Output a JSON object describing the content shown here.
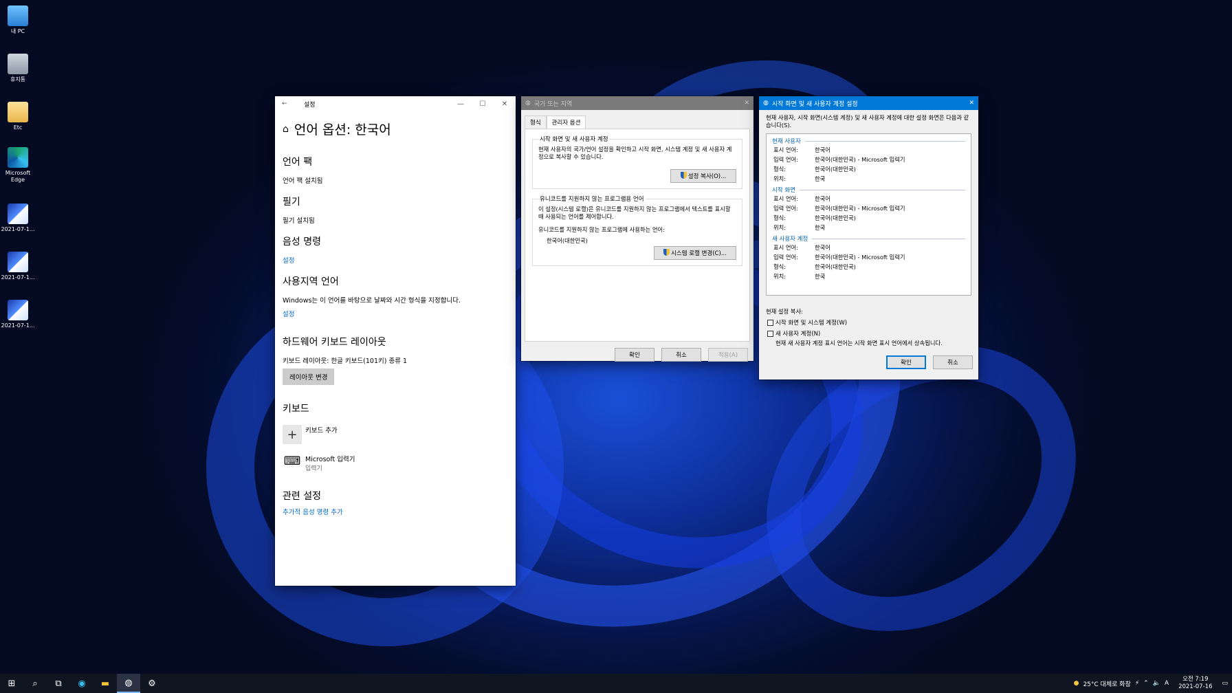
{
  "desktop": {
    "icons": [
      {
        "label": "내 PC",
        "icon": "pc-icon"
      },
      {
        "label": "휴지통",
        "icon": "recycle-bin-icon"
      },
      {
        "label": "Etc",
        "icon": "folder-icon"
      },
      {
        "label": "Microsoft Edge",
        "icon": "edge-icon"
      },
      {
        "label": "2021-07-1...",
        "icon": "image-file-icon"
      },
      {
        "label": "2021-07-1...",
        "icon": "image-file-icon"
      },
      {
        "label": "2021-07-1...",
        "icon": "image-file-icon"
      }
    ]
  },
  "settings": {
    "window_title": "설정",
    "page_title": "언어 옵션: 한국어",
    "language_pack": {
      "heading": "언어 팩",
      "status": "언어 팩 설치됨"
    },
    "handwriting": {
      "heading": "필기",
      "status": "필기 설치됨"
    },
    "speech": {
      "heading": "음성 명령",
      "link": "설정"
    },
    "regional": {
      "heading": "사용지역 언어",
      "description": "Windows는 이 언어를 바탕으로 날짜와 시간 형식을 지정합니다.",
      "link": "설정"
    },
    "hardware_keyboard": {
      "heading": "하드웨어 키보드 레이아웃",
      "layout_label": "키보드 레이아웃:",
      "layout_value": "한글 키보드(101키) 종류 1",
      "change_button": "레이아웃 변경"
    },
    "keyboards": {
      "heading": "키보드",
      "add_label": "키보드 추가",
      "ime_name": "Microsoft 입력기",
      "ime_sub": "입력기"
    },
    "related": {
      "heading": "관련 설정",
      "link": "추가적 음성 명령 추가"
    }
  },
  "region": {
    "window_title": "국가 또는 지역",
    "tabs": [
      "형식",
      "관리자 옵션"
    ],
    "welcome_group": {
      "legend": "시작 화면 및 새 사용자 계정",
      "text": "현재 사용자의 국가/언어 설정을 확인하고 시작 화면, 시스템 계정 및 새 사용자 계정으로 복사할 수 있습니다.",
      "button": "설정 복사(O)..."
    },
    "unicode_group": {
      "legend": "유니코드를 지원하지 않는 프로그램용 언어",
      "text": "이 설정(시스템 로캘)은 유니코드를 지원하지 않는 프로그램에서 텍스트를 표시할 때 사용되는 언어를 제어합니다.",
      "label": "유니코드를 지원하지 않는 프로그램에 사용하는 언어:",
      "value": "한국어(대한민국)",
      "button": "시스템 로캘 변경(C)..."
    },
    "buttons": {
      "ok": "확인",
      "cancel": "취소",
      "apply": "적용(A)"
    }
  },
  "welcome": {
    "window_title": "시작 화면 및 새 사용자 계정 설정",
    "intro": "현재 사용자, 시작 화면(시스템 계정) 및 새 사용자 계정에 대한 설정 화면은 다음과 같습니다(S).",
    "sections": [
      {
        "title": "현재 사용자",
        "rows": [
          [
            "표시 언어:",
            "한국어"
          ],
          [
            "입력 언어:",
            "한국어(대한민국) - Microsoft 입력기"
          ],
          [
            "형식:",
            "한국어(대한민국)"
          ],
          [
            "위치:",
            "한국"
          ]
        ]
      },
      {
        "title": "시작 화면",
        "rows": [
          [
            "표시 언어:",
            "한국어"
          ],
          [
            "입력 언어:",
            "한국어(대한민국) - Microsoft 입력기"
          ],
          [
            "형식:",
            "한국어(대한민국)"
          ],
          [
            "위치:",
            "한국"
          ]
        ]
      },
      {
        "title": "새 사용자 계정",
        "rows": [
          [
            "표시 언어:",
            "한국어"
          ],
          [
            "입력 언어:",
            "한국어(대한민국) - Microsoft 입력기"
          ],
          [
            "형식:",
            "한국어(대한민국)"
          ],
          [
            "위치:",
            "한국"
          ]
        ]
      }
    ],
    "copy_label": "현재 설정 복사:",
    "check_welcome": "시작 화면 및 시스템 계정(W)",
    "check_new_user": "새 사용자 계정(N)",
    "note": "현재 새 사용자 계정 표시 언어는 시작 화면 표시 언어에서 상속됩니다.",
    "buttons": {
      "ok": "확인",
      "cancel": "취소"
    }
  },
  "taskbar": {
    "weather": "25°C 대체로 화창",
    "ime_indicator": "A",
    "time": "오전 7:19",
    "date": "2021-07-16"
  }
}
